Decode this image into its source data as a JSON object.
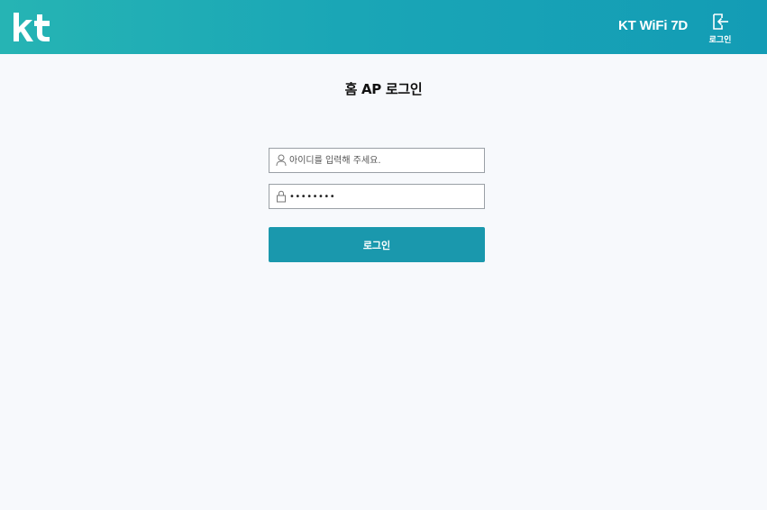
{
  "header": {
    "logo_text": "kt",
    "product_name": "KT WiFi 7D",
    "logout_label": "로그인"
  },
  "page": {
    "title": "홈 AP 로그인"
  },
  "form": {
    "id_placeholder": "아이디를 입력해 주세요.",
    "id_value": "",
    "password_value": "••••••••",
    "submit_label": "로그인"
  },
  "colors": {
    "header_gradient_start": "#26b4b4",
    "header_gradient_end": "#139cb5",
    "button": "#1a98ad",
    "background": "#f7f9fc"
  },
  "icons": {
    "logo": "kt-logo",
    "logout": "login-arrow-icon",
    "user": "user-icon",
    "lock": "lock-icon"
  }
}
